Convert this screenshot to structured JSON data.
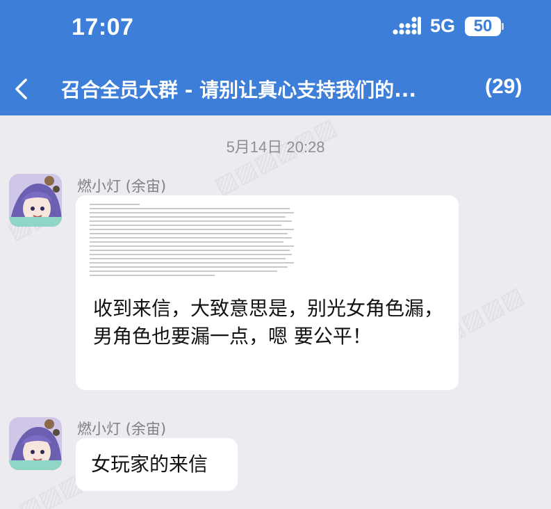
{
  "status_bar": {
    "time": "17:07",
    "network": "5G",
    "battery": "50"
  },
  "nav": {
    "back_icon": "chevron-left-icon",
    "title": "召合全员大群 - 请别让真心支持我们的...",
    "member_count": "(29)"
  },
  "colors": {
    "header_bg": "#3d7fd8",
    "chat_bg": "#ececf0",
    "bubble_bg": "#ffffff",
    "secondary_text": "#7d8087"
  },
  "chat": {
    "date_divider": "5月14日 20:28",
    "messages": [
      {
        "sender": "燃小灯 (余宙)",
        "has_image": true,
        "text": "收到来信，大致意思是，别光女角色漏，男角色也要漏一点，嗯 要公平！"
      },
      {
        "sender": "燃小灯 (余宙)",
        "has_image": false,
        "text": "女玩家的来信"
      }
    ]
  }
}
